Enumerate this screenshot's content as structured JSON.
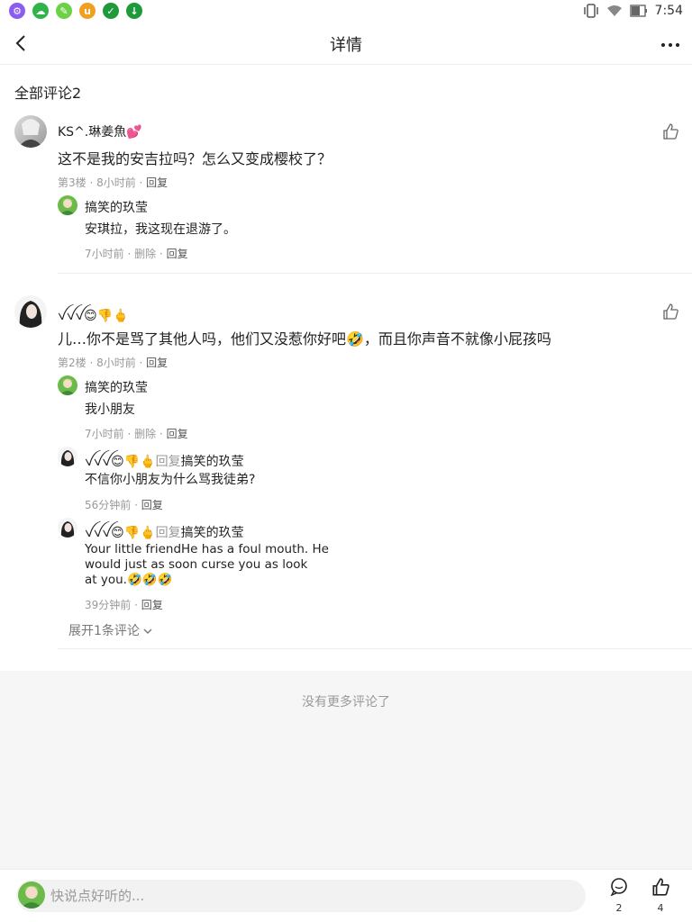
{
  "status_bar": {
    "time": "7:54"
  },
  "nav": {
    "title": "详情"
  },
  "section": {
    "title": "全部评论2"
  },
  "comments": [
    {
      "user": "KS^.琳姜魚💕",
      "text": "这不是我的安吉拉吗？怎么又变成樱校了？",
      "meta_prefix": "第3楼 · 8小时前 · ",
      "reply_label": "回复",
      "replies": [
        {
          "user": "搞笑的玖莹",
          "text": "安琪拉，我这现在退游了。",
          "meta_prefix": "7小时前 · ",
          "delete_label": "删除",
          "reply_label": "回复"
        }
      ]
    },
    {
      "user": "ꪜꪜꪜ😊👎🖕",
      "text": "儿…你不是骂了其他人吗，他们又没惹你好吧🤣，而且你声音不就像小屁孩吗",
      "meta_prefix": "第2楼 · 8小时前 · ",
      "reply_label": "回复",
      "replies": [
        {
          "user": "搞笑的玖莹",
          "text": "我小朋友",
          "meta_prefix": "7小时前 · ",
          "delete_label": "删除",
          "reply_label": "回复"
        },
        {
          "user": "ꪜꪜꪜ😊👎🖕",
          "reply_word": "回复",
          "target": "搞笑的玖莹",
          "text": "不信你小朋友为什么骂我徒弟?",
          "meta_prefix": "56分钟前 · ",
          "reply_label": "回复"
        },
        {
          "user": "ꪜꪜꪜ😊👎🖕",
          "reply_word": "回复",
          "target": "搞笑的玖莹",
          "text_line1": "Your little friendHe has a foul mouth. He",
          "text_line2": "would just as soon curse you as look",
          "text_line3": "at you.🤣🤣🤣",
          "meta_prefix": "39分钟前 · ",
          "reply_label": "回复"
        }
      ],
      "expand_label": "展开1条评论"
    }
  ],
  "footer": {
    "no_more": "没有更多评论了"
  },
  "bottom_bar": {
    "placeholder": "快说点好听的...",
    "comment_count": "2",
    "like_count": "4"
  }
}
